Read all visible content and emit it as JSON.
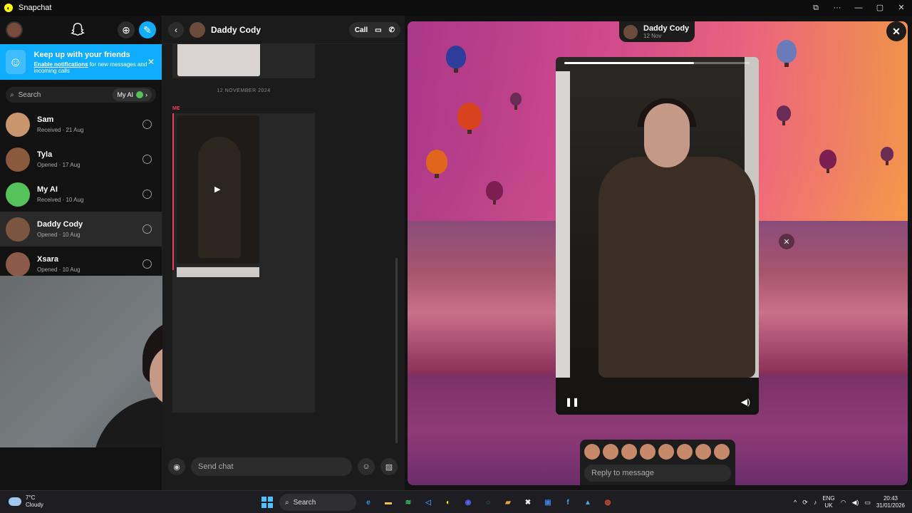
{
  "window": {
    "title": "Snapchat",
    "controls": [
      "⧉",
      "···",
      "—",
      "▢",
      "✕"
    ]
  },
  "sidebar": {
    "banner": {
      "title": "Keep up with your friends",
      "link": "Enable notifications",
      "rest": " for new messages and incoming calls"
    },
    "search": {
      "placeholder": "Search",
      "myai": "My AI"
    },
    "contacts": [
      {
        "name": "Sam",
        "status": "Received · 21 Aug",
        "color": "#c9956f"
      },
      {
        "name": "Tyla",
        "status": "Opened · 17 Aug",
        "color": "#8a5a3c"
      },
      {
        "name": "My AI",
        "status": "Received · 10 Aug",
        "color": "#56c25a"
      },
      {
        "name": "Daddy Cody",
        "status": "Opened · 10 Aug",
        "color": "#7a5540"
      },
      {
        "name": "Xsara",
        "status": "Opened · 10 Aug",
        "color": "#8b5a48"
      }
    ]
  },
  "chat": {
    "name": "Daddy Cody",
    "call_label": "Call",
    "date_separator": "12 NOVEMBER 2024",
    "me_label": "ME",
    "input_placeholder": "Send chat"
  },
  "viewer": {
    "sender": "Daddy Cody",
    "date": "12 Nov",
    "reply_placeholder": "Reply to message",
    "progress": 0.7,
    "reaction_count": 8
  },
  "taskbar": {
    "weather_temp": "7°C",
    "weather_desc": "Cloudy",
    "search": "Search",
    "lang_top": "ENG",
    "lang_bottom": "UK",
    "time": "20:43",
    "date": "31/01/2026",
    "apps": [
      {
        "name": "edge",
        "glyph": "e",
        "color": "#2b9be0"
      },
      {
        "name": "file-explorer",
        "glyph": "▬",
        "color": "#f2c14e"
      },
      {
        "name": "spotify",
        "glyph": "≋",
        "color": "#1ed760"
      },
      {
        "name": "vscode",
        "glyph": "◁",
        "color": "#2c8ee0"
      },
      {
        "name": "snapchat",
        "glyph": "◐",
        "color": "#fffc00"
      },
      {
        "name": "discord",
        "glyph": "◉",
        "color": "#5865f2"
      },
      {
        "name": "browser",
        "glyph": "◌",
        "color": "#3fa2e9"
      },
      {
        "name": "game",
        "glyph": "▰",
        "color": "#e4a93b"
      },
      {
        "name": "xbox",
        "glyph": "✖",
        "color": "#eeeeee"
      },
      {
        "name": "todo",
        "glyph": "▣",
        "color": "#3b7dd8"
      },
      {
        "name": "finance",
        "glyph": "f",
        "color": "#4ba3e8"
      },
      {
        "name": "photos",
        "glyph": "▲",
        "color": "#4aa8e0"
      },
      {
        "name": "chrome",
        "glyph": "◍",
        "color": "#d44a3a"
      }
    ]
  }
}
